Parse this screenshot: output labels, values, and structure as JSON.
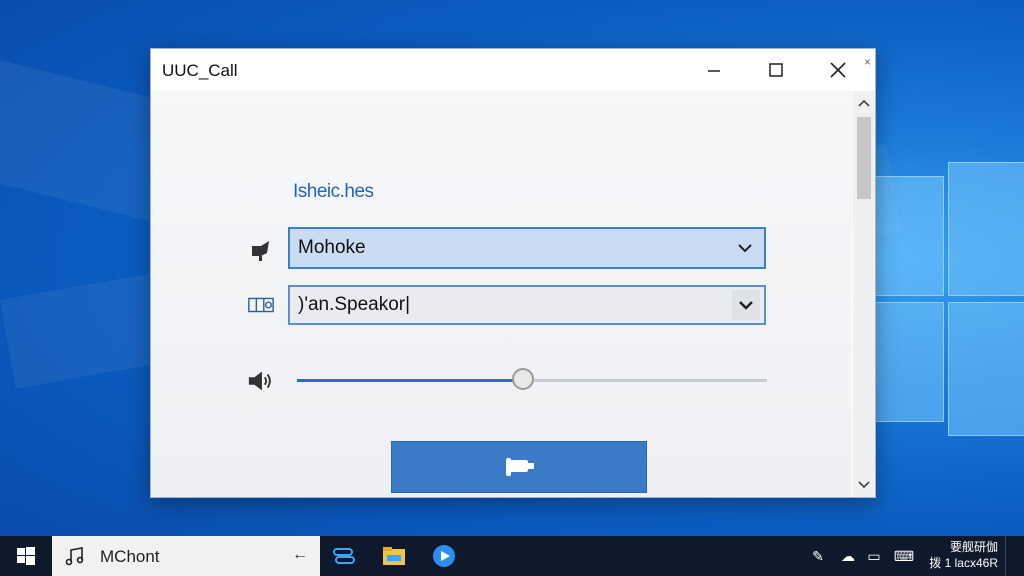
{
  "window": {
    "title": "UUC_Call",
    "small_close": "×"
  },
  "content": {
    "link_text": "Isheic.hes",
    "microphone": {
      "icon": "microphone-icon",
      "selected": "Mohoke"
    },
    "speaker": {
      "icon": "speaker-device-icon",
      "selected": ")'an.Speakor|"
    },
    "volume": {
      "icon": "volume-icon",
      "level_percent": 48
    },
    "call_button": {
      "icon": "phone-call-icon"
    }
  },
  "taskbar": {
    "search_text": "MChont",
    "apps": [
      "task-view-icon",
      "file-explorer-icon",
      "media-player-icon"
    ],
    "clock_line1": "要舰研伽",
    "clock_line2": "拨 1 lacx46R"
  },
  "colors": {
    "accent": "#3a7bc8",
    "selected_field": "#c9dcf2",
    "link": "#2566b4",
    "desktop": "#0b5cc0"
  }
}
